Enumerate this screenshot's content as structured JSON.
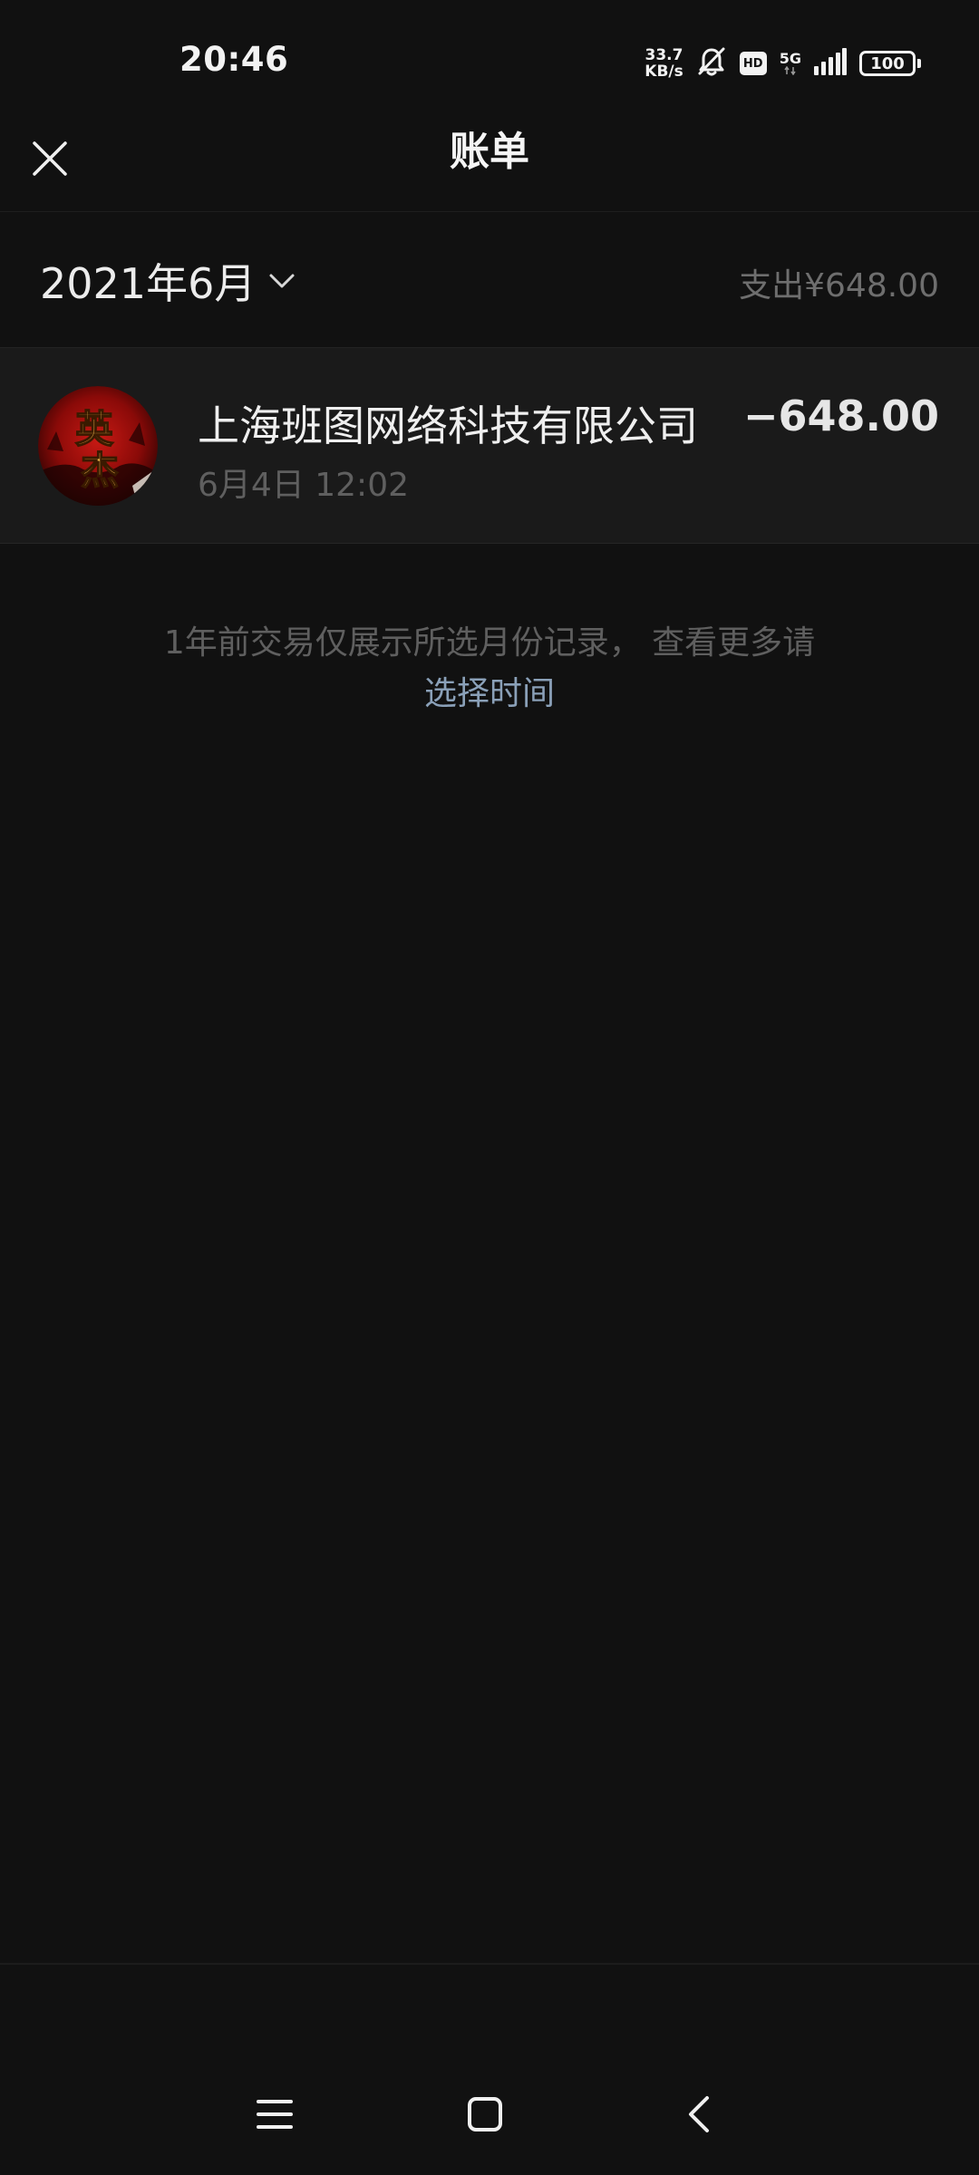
{
  "status_bar": {
    "time": "20:46",
    "net_speed_value": "33.7",
    "net_speed_unit": "KB/s",
    "hd": "HD",
    "network": "5G",
    "battery": "100",
    "icons": [
      "bell-off-icon",
      "hd-icon",
      "signal-icon",
      "battery-icon"
    ]
  },
  "header": {
    "title": "账单",
    "close_icon": "close-icon"
  },
  "month_bar": {
    "month": "2021年6月",
    "expense_total": "支出¥648.00",
    "dropdown_icon": "chevron-down-icon"
  },
  "transactions": [
    {
      "merchant": "上海班图网络科技有限公司",
      "time": "6月4日 12:02",
      "amount": "−648.00",
      "avatar_text": "英杰"
    }
  ],
  "notice": {
    "text": "1年前交易仅展示所选月份记录， 查看更多请",
    "link": "选择时间"
  },
  "colors": {
    "background": "#111111",
    "row_background": "#1a1a1a",
    "link": "#8aa0b8",
    "muted_text": "#5f5f5f"
  },
  "nav": {
    "buttons": [
      "menu-icon",
      "home-icon",
      "back-icon"
    ]
  }
}
